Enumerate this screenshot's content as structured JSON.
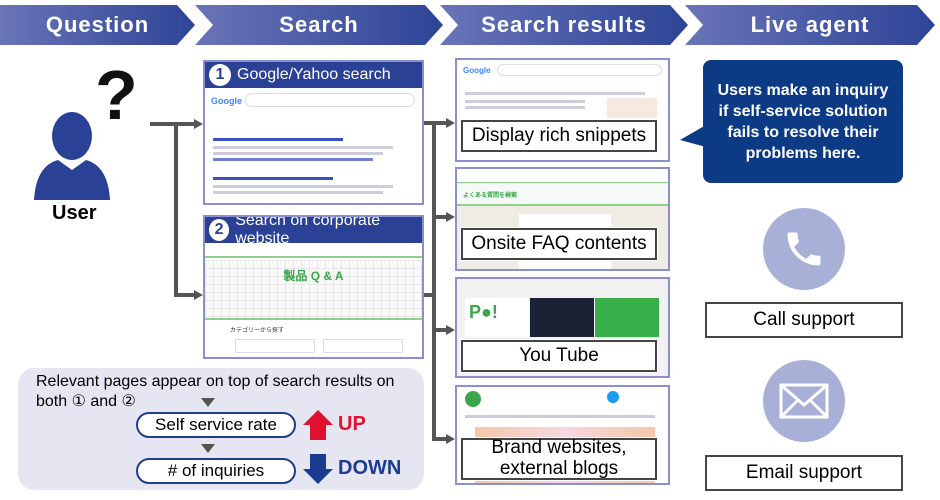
{
  "header": {
    "steps": [
      {
        "label": "Question"
      },
      {
        "label": "Search"
      },
      {
        "label": "Search results"
      },
      {
        "label": "Live agent"
      }
    ]
  },
  "user": {
    "label": "User",
    "question_mark": "?",
    "icon": "person-icon"
  },
  "search": {
    "google": {
      "number": "1",
      "title": "Google/Yahoo search"
    },
    "corporate": {
      "number": "2",
      "title": "Search on corporate website",
      "page_heading": "製品 Q & A",
      "category_heading": "カテゴリーから探す"
    }
  },
  "results": [
    {
      "label": "Display rich snippets"
    },
    {
      "label": "Onsite FAQ contents",
      "page_heading": "よくある質問を検索"
    },
    {
      "label": "You Tube"
    },
    {
      "label": "Brand websites,\nexternal blogs"
    }
  ],
  "live_agent": {
    "bubble": "Users make an inquiry if self-service solution fails to resolve their problems here.",
    "call": "Call support",
    "email": "Email support",
    "icons": [
      "phone-icon",
      "envelope-icon"
    ]
  },
  "summary": {
    "text": "Relevant pages appear on top of search results on both ① and ②",
    "self_service": "Self service rate",
    "up": "UP",
    "inquiries": "# of inquiries",
    "down": "DOWN"
  },
  "colors": {
    "header": "#2d4496",
    "bubble": "#0c3a85",
    "up": "#e0112f",
    "down": "#1a3b91",
    "circle": "#a9b0d8",
    "summary_bg": "#e6e6f2"
  }
}
